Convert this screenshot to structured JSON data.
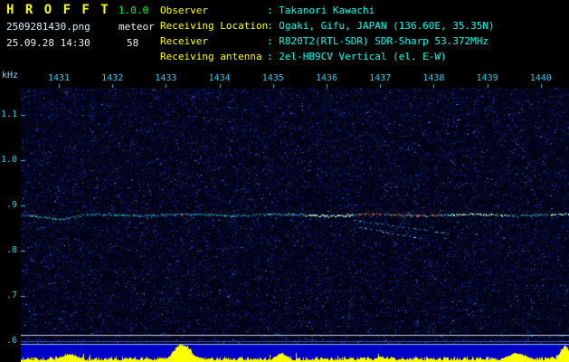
{
  "app": {
    "title": "H R O F F T",
    "version": "1.0.0",
    "filename": "2509281430.png",
    "mode": "meteor",
    "datetime": "25.09.28 14:30",
    "count": "58"
  },
  "station": {
    "rows": [
      {
        "label": "Observer",
        "value": ": Takanori Kawachi"
      },
      {
        "label": "Receiving Location",
        "value": ": Ogaki, Gifu, JAPAN (136.60E, 35.35N)"
      },
      {
        "label": "Receiver",
        "value": ": R820T2(RTL-SDR) SDR-Sharp 53.372MHz"
      },
      {
        "label": "Receiving antenna",
        "value": ": 2el-HB9CV Vertical (el. E-W)"
      }
    ]
  },
  "axes": {
    "y_unit": "kHz"
  },
  "chart_data": {
    "type": "heatmap",
    "subtype": "radio-meteor-spectrogram",
    "title": "",
    "x_axis": {
      "unit": "time (HHMM)",
      "tick_labels": [
        "1431",
        "1432",
        "1433",
        "1434",
        "1435",
        "1436",
        "1437",
        "1438",
        "1439",
        "1440"
      ],
      "tick_values": [
        1431,
        1432,
        1433,
        1434,
        1435,
        1436,
        1437,
        1438,
        1439,
        1440
      ],
      "range_minutes": [
        1430.3,
        1440.55
      ]
    },
    "y_axis": {
      "unit": "kHz",
      "tick_labels": [
        "1.1",
        "1.0",
        ".9",
        ".8",
        ".7",
        ".6"
      ],
      "tick_values": [
        1.1,
        1.0,
        0.9,
        0.8,
        0.7,
        0.6
      ],
      "range_khz": [
        0.598,
        1.168
      ]
    },
    "background_noise": {
      "floor_color": "#010212",
      "speckle_colors": [
        "#000448",
        "#001a8a",
        "#0d3cb4",
        "#3c82ff"
      ],
      "speckle_count": 42000,
      "hot_pixel_count": 130,
      "hot_pixel_colors": [
        "#6ab4ff",
        "#9adcff",
        "#4e9aff"
      ]
    },
    "carrier_trace": {
      "freq_khz": 0.88,
      "dim_colors": [
        "#008c9c",
        "#00aa9a",
        "#2cc8c8",
        "#0678c8"
      ],
      "bright_colors": [
        "#aaffc8",
        "#ffffff",
        "#7dffb4",
        "#d2ffe6"
      ],
      "bright_segments_minutes": [
        [
          1435.6,
          1436.5
        ],
        [
          1438.3,
          1439.4
        ],
        [
          1440.15,
          1440.55
        ]
      ],
      "red_segment_minutes": [
        1436.6,
        1438.2
      ],
      "red_colors": [
        "#ff4632",
        "#ff8c3c"
      ],
      "red_dot_minute": 1433.28,
      "left_dip": {
        "center_minute": 1431.05,
        "depth_khz": 0.008,
        "sigma_minutes": 0.25
      }
    },
    "echo_traces": [
      {
        "t_start": 1436.5,
        "f_start": 0.868,
        "t_end": 1438.3,
        "f_end": 0.838
      },
      {
        "t_start": 1436.6,
        "f_start": 0.852,
        "t_end": 1437.9,
        "f_end": 0.824
      }
    ],
    "marker_lines": [
      {
        "freq_khz": 0.614,
        "color": "#c8d4e8"
      },
      {
        "freq_khz": 0.6,
        "color": "#4254e0"
      }
    ],
    "signal_strip": {
      "background": "#0000c8",
      "bar_color": "#ffff00",
      "top_border_color": "#8fb8ff",
      "base_level_range": [
        0.08,
        0.3
      ],
      "bursts": [
        {
          "center_minute": 1431.2,
          "level": 0.5,
          "sigma_minutes": 0.18
        },
        {
          "center_minute": 1433.3,
          "level": 1.2,
          "sigma_minutes": 0.16
        },
        {
          "center_minute": 1435.15,
          "level": 0.55,
          "sigma_minutes": 0.12
        },
        {
          "center_minute": 1437.0,
          "level": 0.35,
          "sigma_minutes": 0.1
        },
        {
          "center_minute": 1439.55,
          "level": 0.55,
          "sigma_minutes": 0.2
        },
        {
          "center_minute": 1440.45,
          "level": 1.0,
          "sigma_minutes": 0.1
        }
      ]
    }
  }
}
